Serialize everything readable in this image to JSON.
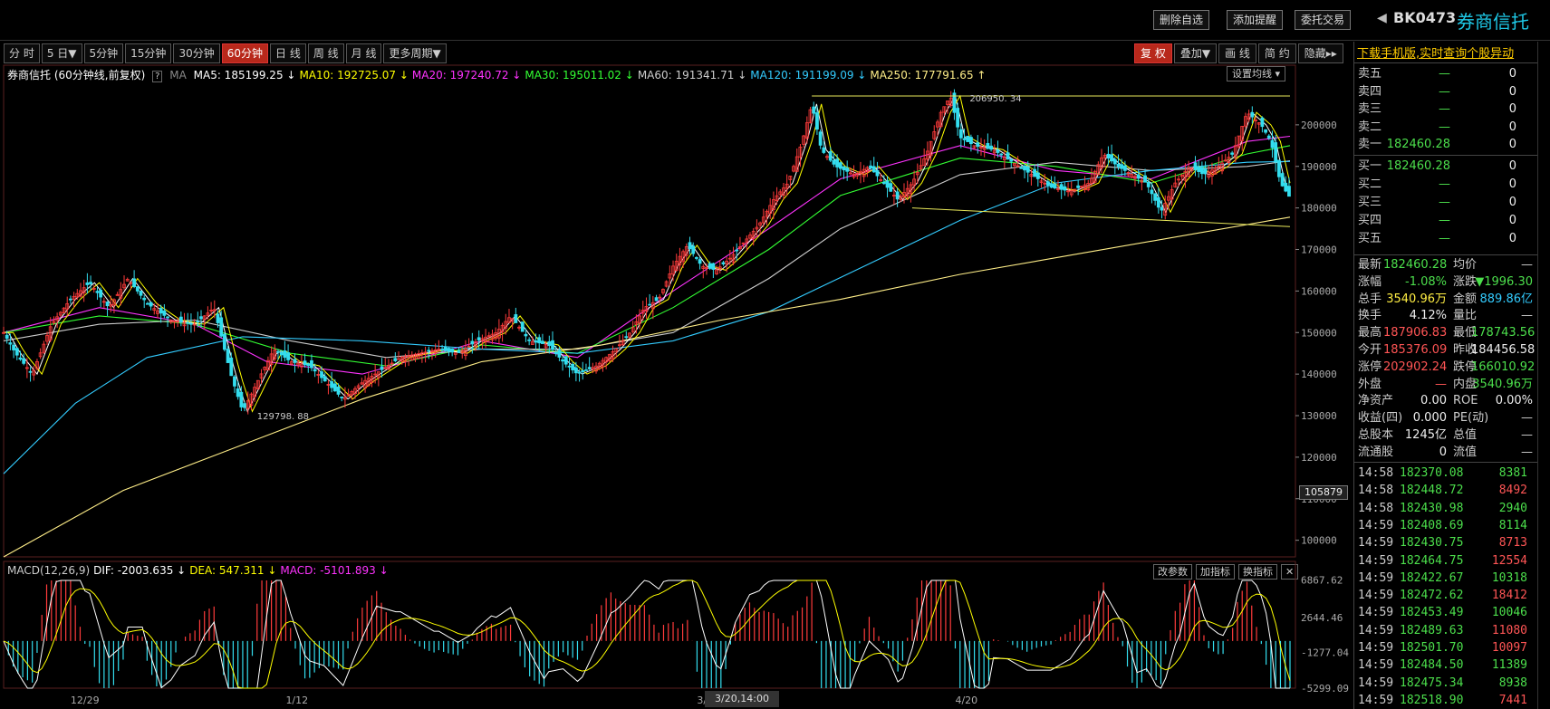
{
  "header": {
    "buttons": [
      "删除自选",
      "添加提醒",
      "委托交易"
    ],
    "code": "BK0473",
    "name": "券商信托"
  },
  "periods": [
    {
      "label": "分 时",
      "active": false
    },
    {
      "label": "5 日▼",
      "active": false
    },
    {
      "label": "5分钟",
      "active": false
    },
    {
      "label": "15分钟",
      "active": false
    },
    {
      "label": "30分钟",
      "active": false
    },
    {
      "label": "60分钟",
      "active": true
    },
    {
      "label": "日 线",
      "active": false
    },
    {
      "label": "周 线",
      "active": false
    },
    {
      "label": "月 线",
      "active": false
    },
    {
      "label": "更多周期▼",
      "active": false
    }
  ],
  "toolbar_right": [
    "复 权",
    "叠加▼",
    "画 线",
    "简 约",
    "隐藏▸▸"
  ],
  "chart_title": "券商信托 (60分钟线,前复权)",
  "ma_legend": [
    {
      "label": "MA5: 185199.25 ↓",
      "color": "#ffffff"
    },
    {
      "label": "MA10: 192725.07 ↓",
      "color": "#ffff00"
    },
    {
      "label": "MA20: 197240.72 ↓",
      "color": "#ff33ff"
    },
    {
      "label": "MA30: 195011.02 ↓",
      "color": "#33ff33"
    },
    {
      "label": "MA60: 191341.71 ↓",
      "color": "#cccccc"
    },
    {
      "label": "MA120: 191199.09 ↓",
      "color": "#33ccff"
    },
    {
      "label": "MA250: 177791.65 ↑",
      "color": "#ffee88"
    }
  ],
  "set_ma_label": "设置均线",
  "macd_legend": [
    {
      "label": "MACD(12,26,9)",
      "color": "#cccccc"
    },
    {
      "label": "DIF: -2003.635 ↓",
      "color": "#ffffff"
    },
    {
      "label": "DEA: 547.311 ↓",
      "color": "#ffff00"
    },
    {
      "label": "MACD: -5101.893 ↓",
      "color": "#ff33ff"
    }
  ],
  "indicator_buttons": [
    "改参数",
    "加指标",
    "换指标",
    "✕"
  ],
  "current_value_tag": "105879",
  "cursor_date": "3/20,14:00",
  "annotations": {
    "high": "206950. 34",
    "low": "129798. 88"
  },
  "chart_data": {
    "type": "candlestick",
    "title": "券商信托 (60分钟线,前复权)",
    "y_ticks": [
      200000,
      190000,
      180000,
      170000,
      160000,
      150000,
      140000,
      130000,
      120000,
      110000,
      100000
    ],
    "ylim": [
      96000,
      210000
    ],
    "x_ticks": [
      "12/29",
      "1/12",
      "3/2",
      "4/20"
    ],
    "macd_ticks": [
      "6867.62",
      "2644.46",
      "-1277.04",
      "-5299.09"
    ],
    "macd_ylim": [
      -5300,
      6900
    ],
    "price_path": [
      [
        0,
        150000
      ],
      [
        5,
        145000
      ],
      [
        12,
        140000
      ],
      [
        20,
        152000
      ],
      [
        28,
        158000
      ],
      [
        36,
        162000
      ],
      [
        44,
        156000
      ],
      [
        52,
        163000
      ],
      [
        60,
        157000
      ],
      [
        70,
        153000
      ],
      [
        80,
        152000
      ],
      [
        88,
        156000
      ],
      [
        95,
        140000
      ],
      [
        100,
        131000
      ],
      [
        106,
        138000
      ],
      [
        113,
        146000
      ],
      [
        120,
        143000
      ],
      [
        128,
        142000
      ],
      [
        135,
        138000
      ],
      [
        142,
        134000
      ],
      [
        150,
        138000
      ],
      [
        158,
        141000
      ],
      [
        166,
        144000
      ],
      [
        174,
        145000
      ],
      [
        182,
        146000
      ],
      [
        190,
        145000
      ],
      [
        198,
        148000
      ],
      [
        206,
        150000
      ],
      [
        212,
        154000
      ],
      [
        220,
        148000
      ],
      [
        228,
        147000
      ],
      [
        234,
        143000
      ],
      [
        240,
        140000
      ],
      [
        248,
        142000
      ],
      [
        256,
        146000
      ],
      [
        262,
        150000
      ],
      [
        268,
        156000
      ],
      [
        274,
        158000
      ],
      [
        280,
        166000
      ],
      [
        286,
        171000
      ],
      [
        292,
        166000
      ],
      [
        298,
        165000
      ],
      [
        304,
        168000
      ],
      [
        310,
        172000
      ],
      [
        316,
        176000
      ],
      [
        322,
        182000
      ],
      [
        328,
        186000
      ],
      [
        334,
        196000
      ],
      [
        338,
        205000
      ],
      [
        342,
        194000
      ],
      [
        348,
        190000
      ],
      [
        356,
        188000
      ],
      [
        362,
        190000
      ],
      [
        368,
        186000
      ],
      [
        374,
        182000
      ],
      [
        380,
        186000
      ],
      [
        386,
        193000
      ],
      [
        392,
        203000
      ],
      [
        396,
        206950
      ],
      [
        400,
        197000
      ],
      [
        406,
        195000
      ],
      [
        414,
        194000
      ],
      [
        422,
        191000
      ],
      [
        430,
        188000
      ],
      [
        438,
        185000
      ],
      [
        446,
        184000
      ],
      [
        454,
        186000
      ],
      [
        460,
        193000
      ],
      [
        466,
        190000
      ],
      [
        472,
        188000
      ],
      [
        478,
        186000
      ],
      [
        484,
        179000
      ],
      [
        490,
        186000
      ],
      [
        496,
        190000
      ],
      [
        502,
        188000
      ],
      [
        508,
        190000
      ],
      [
        514,
        193000
      ],
      [
        520,
        203000
      ],
      [
        526,
        200000
      ],
      [
        530,
        196000
      ],
      [
        534,
        186000
      ],
      [
        538,
        182460
      ]
    ],
    "ma_lines": [
      {
        "name": "MA20",
        "color": "#ff33ff",
        "points": [
          [
            0,
            150000
          ],
          [
            40,
            156000
          ],
          [
            80,
            152000
          ],
          [
            110,
            143000
          ],
          [
            150,
            140000
          ],
          [
            200,
            148000
          ],
          [
            240,
            144000
          ],
          [
            280,
            160000
          ],
          [
            320,
            175000
          ],
          [
            350,
            187000
          ],
          [
            400,
            195000
          ],
          [
            440,
            189000
          ],
          [
            480,
            187000
          ],
          [
            520,
            196000
          ],
          [
            538,
            197240
          ]
        ]
      },
      {
        "name": "MA30",
        "color": "#33ff33",
        "points": [
          [
            0,
            150000
          ],
          [
            40,
            154000
          ],
          [
            80,
            152000
          ],
          [
            120,
            145000
          ],
          [
            160,
            142000
          ],
          [
            200,
            147000
          ],
          [
            240,
            145000
          ],
          [
            280,
            156000
          ],
          [
            320,
            170000
          ],
          [
            350,
            183000
          ],
          [
            400,
            192000
          ],
          [
            440,
            190000
          ],
          [
            480,
            186000
          ],
          [
            520,
            193000
          ],
          [
            538,
            195011
          ]
        ]
      },
      {
        "name": "MA60",
        "color": "#cccccc",
        "points": [
          [
            0,
            148000
          ],
          [
            40,
            152000
          ],
          [
            80,
            153000
          ],
          [
            120,
            148000
          ],
          [
            160,
            144000
          ],
          [
            200,
            146000
          ],
          [
            240,
            146000
          ],
          [
            280,
            150000
          ],
          [
            320,
            163000
          ],
          [
            350,
            175000
          ],
          [
            400,
            188000
          ],
          [
            440,
            191000
          ],
          [
            480,
            189000
          ],
          [
            520,
            190000
          ],
          [
            538,
            191341
          ]
        ]
      },
      {
        "name": "MA120",
        "color": "#33ccff",
        "points": [
          [
            0,
            116000
          ],
          [
            30,
            133000
          ],
          [
            60,
            144000
          ],
          [
            100,
            149000
          ],
          [
            150,
            148000
          ],
          [
            200,
            146000
          ],
          [
            240,
            145000
          ],
          [
            280,
            148000
          ],
          [
            320,
            155000
          ],
          [
            360,
            166000
          ],
          [
            400,
            177000
          ],
          [
            440,
            186000
          ],
          [
            480,
            189000
          ],
          [
            520,
            191000
          ],
          [
            538,
            191199
          ]
        ]
      },
      {
        "name": "MA250",
        "color": "#ffee88",
        "points": [
          [
            0,
            96000
          ],
          [
            50,
            112000
          ],
          [
            100,
            123000
          ],
          [
            150,
            134000
          ],
          [
            200,
            143000
          ],
          [
            250,
            147000
          ],
          [
            300,
            153000
          ],
          [
            350,
            158000
          ],
          [
            400,
            164000
          ],
          [
            450,
            169000
          ],
          [
            500,
            174000
          ],
          [
            538,
            177791
          ]
        ]
      }
    ],
    "trend_lines": [
      {
        "points": [
          [
            338,
            206950
          ],
          [
            538,
            206950
          ]
        ]
      },
      {
        "points": [
          [
            380,
            180000
          ],
          [
            538,
            175500
          ]
        ]
      }
    ]
  },
  "order_book": {
    "sell": [
      {
        "label": "卖五",
        "price": "—",
        "vol": "0"
      },
      {
        "label": "卖四",
        "price": "—",
        "vol": "0"
      },
      {
        "label": "卖三",
        "price": "—",
        "vol": "0"
      },
      {
        "label": "卖二",
        "price": "—",
        "vol": "0"
      },
      {
        "label": "卖一",
        "price": "182460.28",
        "vol": "0"
      }
    ],
    "buy": [
      {
        "label": "买一",
        "price": "182460.28",
        "vol": "0"
      },
      {
        "label": "买二",
        "price": "—",
        "vol": "0"
      },
      {
        "label": "买三",
        "price": "—",
        "vol": "0"
      },
      {
        "label": "买四",
        "price": "—",
        "vol": "0"
      },
      {
        "label": "买五",
        "price": "—",
        "vol": "0"
      }
    ]
  },
  "promo": "下载手机版,实时查询个股异动",
  "stats": [
    {
      "l1": "最新",
      "v1": "182460.28",
      "c1": "#4cdf4c",
      "l2": "均价",
      "v2": "—",
      "c2": "#ccc"
    },
    {
      "l1": "涨幅",
      "v1": "-1.08%",
      "c1": "#4cdf4c",
      "l2": "涨跌",
      "v2": "▼1996.30",
      "c2": "#4cdf4c"
    },
    {
      "l1": "总手",
      "v1": "3540.96万",
      "c1": "#ffee44",
      "l2": "金额",
      "v2": "889.86亿",
      "c2": "#33ccff"
    },
    {
      "l1": "换手",
      "v1": "4.12%",
      "c1": "#eee",
      "l2": "量比",
      "v2": "—",
      "c2": "#ccc"
    },
    {
      "l1": "最高",
      "v1": "187906.83",
      "c1": "#ff5555",
      "l2": "最低",
      "v2": "178743.56",
      "c2": "#4cdf4c"
    },
    {
      "l1": "今开",
      "v1": "185376.09",
      "c1": "#ff5555",
      "l2": "昨收",
      "v2": "184456.58",
      "c2": "#eee"
    },
    {
      "l1": "涨停",
      "v1": "202902.24",
      "c1": "#ff5555",
      "l2": "跌停",
      "v2": "166010.92",
      "c2": "#4cdf4c"
    },
    {
      "l1": "外盘",
      "v1": "—",
      "c1": "#ff5555",
      "l2": "内盘",
      "v2": "3540.96万",
      "c2": "#4cdf4c"
    },
    {
      "l1": "净资产",
      "v1": "0.00",
      "c1": "#eee",
      "l2": "ROE",
      "v2": "0.00%",
      "c2": "#eee"
    },
    {
      "l1": "收益(四)",
      "v1": "0.000",
      "c1": "#eee",
      "l2": "PE(动)",
      "v2": "—",
      "c2": "#ccc"
    },
    {
      "l1": "总股本",
      "v1": "1245亿",
      "c1": "#eee",
      "l2": "总值",
      "v2": "—",
      "c2": "#ccc"
    },
    {
      "l1": "流通股",
      "v1": "0",
      "c1": "#eee",
      "l2": "流值",
      "v2": "—",
      "c2": "#ccc"
    }
  ],
  "ticks": [
    {
      "time": "14:58",
      "price": "182370.08",
      "vol": "8381",
      "vc": "#4cdf4c"
    },
    {
      "time": "14:58",
      "price": "182448.72",
      "vol": "8492",
      "vc": "#ff5555"
    },
    {
      "time": "14:58",
      "price": "182430.98",
      "vol": "2940",
      "vc": "#4cdf4c"
    },
    {
      "time": "14:59",
      "price": "182408.69",
      "vol": "8114",
      "vc": "#4cdf4c"
    },
    {
      "time": "14:59",
      "price": "182430.75",
      "vol": "8713",
      "vc": "#ff5555"
    },
    {
      "time": "14:59",
      "price": "182464.75",
      "vol": "12554",
      "vc": "#ff5555"
    },
    {
      "time": "14:59",
      "price": "182422.67",
      "vol": "10318",
      "vc": "#4cdf4c"
    },
    {
      "time": "14:59",
      "price": "182472.62",
      "vol": "18412",
      "vc": "#ff5555"
    },
    {
      "time": "14:59",
      "price": "182453.49",
      "vol": "10046",
      "vc": "#4cdf4c"
    },
    {
      "time": "14:59",
      "price": "182489.63",
      "vol": "11080",
      "vc": "#ff5555"
    },
    {
      "time": "14:59",
      "price": "182501.70",
      "vol": "10097",
      "vc": "#ff5555"
    },
    {
      "time": "14:59",
      "price": "182484.50",
      "vol": "11389",
      "vc": "#4cdf4c"
    },
    {
      "time": "14:59",
      "price": "182475.34",
      "vol": "8938",
      "vc": "#4cdf4c"
    },
    {
      "time": "14:59",
      "price": "182518.90",
      "vol": "7441",
      "vc": "#ff5555"
    }
  ]
}
